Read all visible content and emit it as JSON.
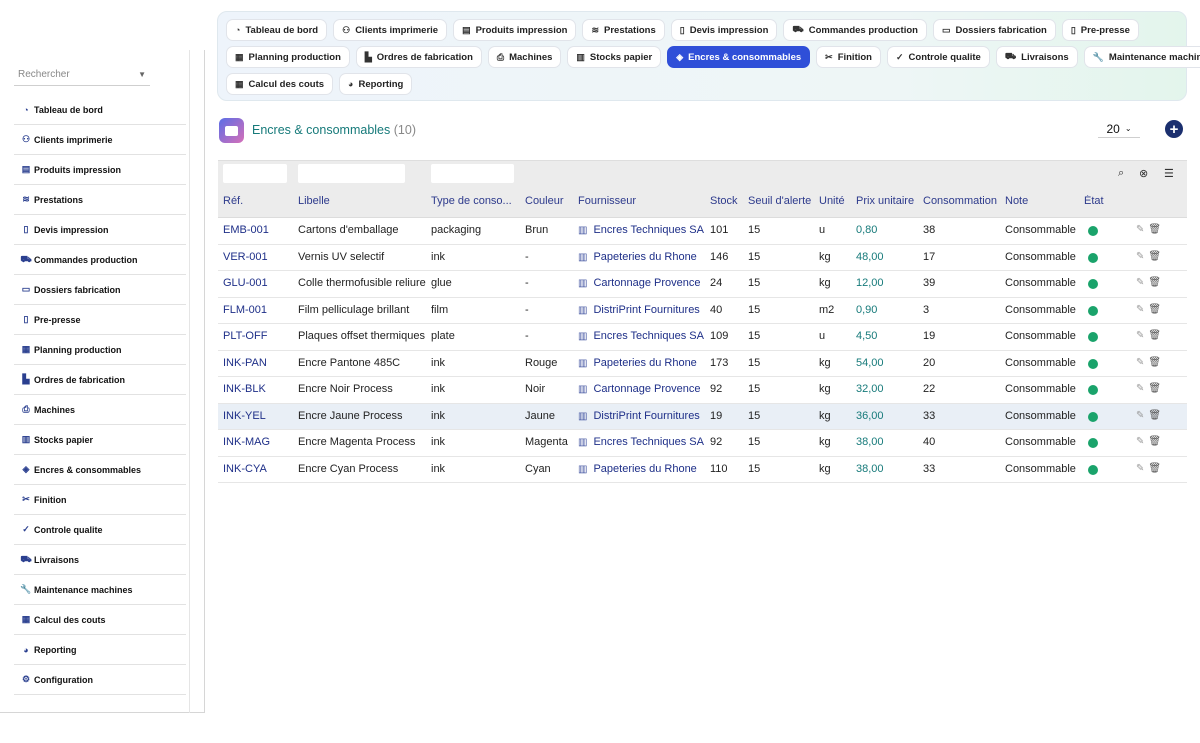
{
  "sidebar": {
    "search_placeholder": "Rechercher",
    "items": [
      {
        "label": "Tableau de bord",
        "icon": "dashboard-icon",
        "glyph": "◔"
      },
      {
        "label": "Clients imprimerie",
        "icon": "users-icon",
        "glyph": "⚇"
      },
      {
        "label": "Produits impression",
        "icon": "box-icon",
        "glyph": "▤"
      },
      {
        "label": "Prestations",
        "icon": "layers-icon",
        "glyph": "≋"
      },
      {
        "label": "Devis impression",
        "icon": "document-icon",
        "glyph": "▯"
      },
      {
        "label": "Commandes production",
        "icon": "cart-icon",
        "glyph": "⛟"
      },
      {
        "label": "Dossiers fabrication",
        "icon": "folder-icon",
        "glyph": "▭"
      },
      {
        "label": "Pre-presse",
        "icon": "file-icon",
        "glyph": "▯"
      },
      {
        "label": "Planning production",
        "icon": "calendar-icon",
        "glyph": "▦"
      },
      {
        "label": "Ordres de fabrication",
        "icon": "factory-icon",
        "glyph": "▙"
      },
      {
        "label": "Machines",
        "icon": "printer-icon",
        "glyph": "⎙"
      },
      {
        "label": "Stocks papier",
        "icon": "paper-stack-icon",
        "glyph": "▥"
      },
      {
        "label": "Encres & consommables",
        "icon": "fill-drip-icon",
        "glyph": "◈"
      },
      {
        "label": "Finition",
        "icon": "scissors-icon",
        "glyph": "✂"
      },
      {
        "label": "Controle qualite",
        "icon": "check-double-icon",
        "glyph": "✓"
      },
      {
        "label": "Livraisons",
        "icon": "truck-icon",
        "glyph": "⛟"
      },
      {
        "label": "Maintenance machines",
        "icon": "wrench-icon",
        "glyph": "🔧"
      },
      {
        "label": "Calcul des couts",
        "icon": "calculator-icon",
        "glyph": "▦"
      },
      {
        "label": "Reporting",
        "icon": "pie-chart-icon",
        "glyph": "◕"
      },
      {
        "label": "Configuration",
        "icon": "gear-icon",
        "glyph": "⚙"
      }
    ]
  },
  "topnav": {
    "row1": [
      {
        "label": "Tableau de bord",
        "icon": "dashboard-icon",
        "glyph": "◔"
      },
      {
        "label": "Clients imprimerie",
        "icon": "users-icon",
        "glyph": "⚇"
      },
      {
        "label": "Produits impression",
        "icon": "box-icon",
        "glyph": "▤"
      },
      {
        "label": "Prestations",
        "icon": "layers-icon",
        "glyph": "≋"
      },
      {
        "label": "Devis impression",
        "icon": "document-icon",
        "glyph": "▯"
      },
      {
        "label": "Commandes production",
        "icon": "cart-icon",
        "glyph": "⛟"
      },
      {
        "label": "Dossiers fabrication",
        "icon": "folder-icon",
        "glyph": "▭"
      },
      {
        "label": "Pre-presse",
        "icon": "file-icon",
        "glyph": "▯"
      }
    ],
    "row2": [
      {
        "label": "Planning production",
        "icon": "calendar-icon",
        "glyph": "▦"
      },
      {
        "label": "Ordres de fabrication",
        "icon": "factory-icon",
        "glyph": "▙"
      },
      {
        "label": "Machines",
        "icon": "printer-icon",
        "glyph": "⎙"
      },
      {
        "label": "Stocks papier",
        "icon": "paper-stack-icon",
        "glyph": "▥"
      },
      {
        "label": "Encres & consommables",
        "icon": "fill-drip-icon",
        "glyph": "◈",
        "active": true
      },
      {
        "label": "Finition",
        "icon": "scissors-icon",
        "glyph": "✂"
      },
      {
        "label": "Controle qualite",
        "icon": "check-double-icon",
        "glyph": "✓"
      },
      {
        "label": "Livraisons",
        "icon": "truck-icon",
        "glyph": "⛟"
      },
      {
        "label": "Maintenance machines",
        "icon": "wrench-icon",
        "glyph": "🔧"
      }
    ],
    "row3": [
      {
        "label": "Calcul des couts",
        "icon": "calculator-icon",
        "glyph": "▦"
      },
      {
        "label": "Reporting",
        "icon": "pie-chart-icon",
        "glyph": "◕"
      }
    ]
  },
  "header": {
    "title": "Encres & consommables",
    "count": "(10)",
    "page_size": "20",
    "add_label": "+"
  },
  "table": {
    "columns": [
      "Réf.",
      "Libelle",
      "Type de conso...",
      "Couleur",
      "Fournisseur",
      "Stock",
      "Seuil d'alerte",
      "Unité",
      "Prix unitaire",
      "Consommation",
      "Note",
      "État"
    ],
    "rows": [
      {
        "ref": "EMB-001",
        "libelle": "Cartons d'emballage",
        "type": "packaging",
        "couleur": "Brun",
        "fournisseur": "Encres Techniques SA",
        "stock": "101",
        "seuil": "15",
        "unite": "u",
        "prix": "0,80",
        "conso": "38",
        "note": "Consommable"
      },
      {
        "ref": "VER-001",
        "libelle": "Vernis UV selectif",
        "type": "ink",
        "couleur": "-",
        "fournisseur": "Papeteries du Rhone",
        "stock": "146",
        "seuil": "15",
        "unite": "kg",
        "prix": "48,00",
        "conso": "17",
        "note": "Consommable"
      },
      {
        "ref": "GLU-001",
        "libelle": "Colle thermofusible reliure",
        "type": "glue",
        "couleur": "-",
        "fournisseur": "Cartonnage Provence",
        "stock": "24",
        "seuil": "15",
        "unite": "kg",
        "prix": "12,00",
        "conso": "39",
        "note": "Consommable"
      },
      {
        "ref": "FLM-001",
        "libelle": "Film pelliculage brillant",
        "type": "film",
        "couleur": "-",
        "fournisseur": "DistriPrint Fournitures",
        "stock": "40",
        "seuil": "15",
        "unite": "m2",
        "prix": "0,90",
        "conso": "3",
        "note": "Consommable"
      },
      {
        "ref": "PLT-OFF",
        "libelle": "Plaques offset thermiques",
        "type": "plate",
        "couleur": "-",
        "fournisseur": "Encres Techniques SA",
        "stock": "109",
        "seuil": "15",
        "unite": "u",
        "prix": "4,50",
        "conso": "19",
        "note": "Consommable"
      },
      {
        "ref": "INK-PAN",
        "libelle": "Encre Pantone 485C",
        "type": "ink",
        "couleur": "Rouge",
        "fournisseur": "Papeteries du Rhone",
        "stock": "173",
        "seuil": "15",
        "unite": "kg",
        "prix": "54,00",
        "conso": "20",
        "note": "Consommable"
      },
      {
        "ref": "INK-BLK",
        "libelle": "Encre Noir Process",
        "type": "ink",
        "couleur": "Noir",
        "fournisseur": "Cartonnage Provence",
        "stock": "92",
        "seuil": "15",
        "unite": "kg",
        "prix": "32,00",
        "conso": "22",
        "note": "Consommable"
      },
      {
        "ref": "INK-YEL",
        "libelle": "Encre Jaune Process",
        "type": "ink",
        "couleur": "Jaune",
        "fournisseur": "DistriPrint Fournitures",
        "stock": "19",
        "seuil": "15",
        "unite": "kg",
        "prix": "36,00",
        "conso": "33",
        "note": "Consommable",
        "highlight": true
      },
      {
        "ref": "INK-MAG",
        "libelle": "Encre Magenta Process",
        "type": "ink",
        "couleur": "Magenta",
        "fournisseur": "Encres Techniques SA",
        "stock": "92",
        "seuil": "15",
        "unite": "kg",
        "prix": "38,00",
        "conso": "40",
        "note": "Consommable"
      },
      {
        "ref": "INK-CYA",
        "libelle": "Encre Cyan Process",
        "type": "ink",
        "couleur": "Cyan",
        "fournisseur": "Papeteries du Rhone",
        "stock": "110",
        "seuil": "15",
        "unite": "kg",
        "prix": "38,00",
        "conso": "33",
        "note": "Consommable"
      }
    ]
  },
  "colors": {
    "accent": "#2f4fd8",
    "title": "#167a7a",
    "status_ok": "#1aa36b",
    "link": "#1e2f88"
  }
}
